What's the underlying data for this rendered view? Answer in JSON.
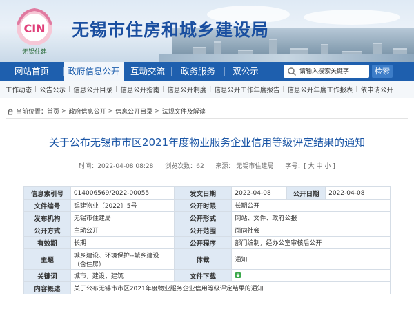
{
  "header": {
    "site_title": "无锡市住房和城乡建设局",
    "logo_text": "CIN",
    "logo_subtext": "无锡住建"
  },
  "nav": {
    "items": [
      {
        "label": "网站首页",
        "active": false
      },
      {
        "label": "政府信息公开",
        "active": true
      },
      {
        "label": "互动交流",
        "active": false
      },
      {
        "label": "政务服务",
        "active": false
      },
      {
        "label": "双公示",
        "active": false
      }
    ],
    "search_placeholder": "请输入搜索关键字",
    "search_button": "检索"
  },
  "subnav": {
    "items": [
      "工作动态",
      "公告公示",
      "信息公开目录",
      "信息公开指南",
      "信息公开制度",
      "信息公开工作年度报告",
      "信息公开年度工作报表",
      "依申请公开"
    ]
  },
  "breadcrumb": {
    "prefix": "当前位置：",
    "items": [
      "首页",
      "政府信息公开",
      "信息公开目录",
      "法规文件及解读"
    ],
    "separator": ">"
  },
  "article": {
    "title": "关于公布无锡市市区2021年度物业服务企业信用等级评定结果的通知",
    "meta": {
      "time": "时间：2022-04-08 08:28",
      "views": "浏览次数：62",
      "source": "来源：  无锡市住建局",
      "font_size": "字号：[ 大 中 小 ]"
    }
  },
  "info_table": {
    "rows": [
      {
        "k1": "信息索引号",
        "v1": "014006569/2022-00055",
        "k2": "发文日期",
        "v2": "2022-04-08",
        "k3": "公开日期",
        "v3": "2022-04-08"
      },
      {
        "k1": "文件编号",
        "v1": "锡建物业〔2022〕5号",
        "k2": "公开时限",
        "v2": "长期公开"
      },
      {
        "k1": "发布机构",
        "v1": "无锡市住建局",
        "k2": "公开形式",
        "v2": "网站、文件、政府公报"
      },
      {
        "k1": "公开方式",
        "v1": "主动公开",
        "k2": "公开范围",
        "v2": "面向社会"
      },
      {
        "k1": "有效期",
        "v1": "长期",
        "k2": "公开程序",
        "v2": "部门编制，经办公室审核后公开"
      },
      {
        "k1": "主题",
        "v1": "城乡建设、环境保护--城乡建设（含住房）",
        "k2": "体裁",
        "v2": "通知"
      },
      {
        "k1": "关键词",
        "v1": "城市，建设，建筑",
        "k2": "文件下载",
        "v2": ""
      },
      {
        "k1": "内容概述",
        "v1": "关于公布无锡市市区2021年度物业服务企业信用等级评定结果的通知"
      }
    ]
  },
  "colors": {
    "nav_bg": "#1e5fae",
    "title_blue": "#1b56a6",
    "key_cell_bg": "#dfe9f4"
  }
}
